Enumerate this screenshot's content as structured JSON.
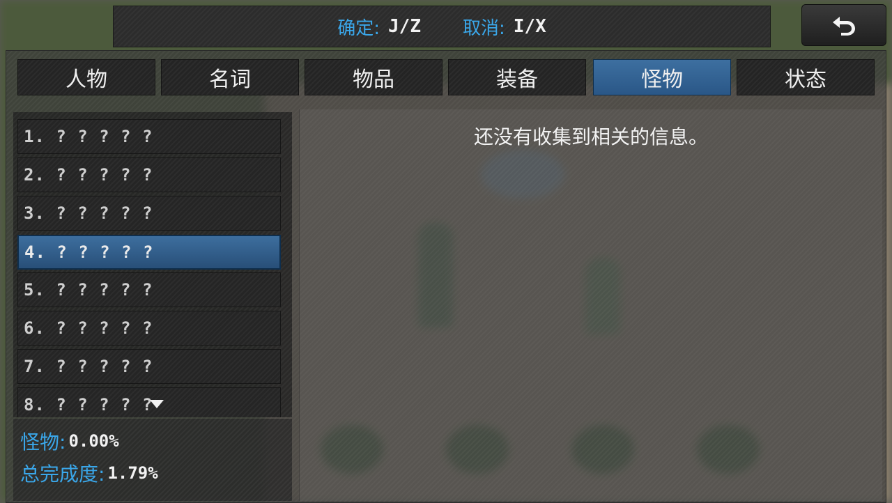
{
  "hint_bar": {
    "confirm_label": "确定:",
    "confirm_keys": "J/Z",
    "cancel_label": "取消:",
    "cancel_keys": "I/X"
  },
  "back_button": {
    "icon": "undo-arrow-icon"
  },
  "tabs": [
    {
      "label": "人物",
      "active": false
    },
    {
      "label": "名词",
      "active": false
    },
    {
      "label": "物品",
      "active": false
    },
    {
      "label": "装备",
      "active": false
    },
    {
      "label": "怪物",
      "active": true
    },
    {
      "label": "状态",
      "active": false
    }
  ],
  "list": {
    "items": [
      {
        "label": "1. ? ? ? ? ?",
        "selected": false
      },
      {
        "label": "2. ? ? ? ? ?",
        "selected": false
      },
      {
        "label": "3. ? ? ? ? ?",
        "selected": false
      },
      {
        "label": "4. ? ? ? ? ?",
        "selected": true
      },
      {
        "label": "5. ? ? ? ? ?",
        "selected": false
      },
      {
        "label": "6. ? ? ? ? ?",
        "selected": false
      },
      {
        "label": "7. ? ? ? ? ?",
        "selected": false
      },
      {
        "label": "8. ? ? ? ? ?",
        "selected": false
      }
    ],
    "scroll_indicator": "down-triangle-icon"
  },
  "stats": {
    "category_label": "怪物:",
    "category_value": "0.00%",
    "total_label": "总完成度:",
    "total_value": "1.79%"
  },
  "detail": {
    "message": "还没有收集到相关的信息。"
  },
  "colors": {
    "accent_blue": "#3aa7ea",
    "selected_bg": "#2f5f8f",
    "text": "#f2f2f2"
  }
}
